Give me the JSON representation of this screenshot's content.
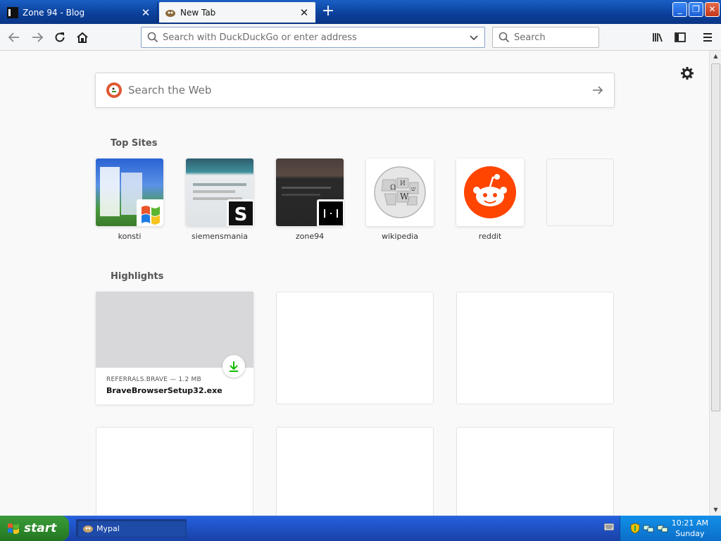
{
  "browser": {
    "tabs": [
      {
        "title": "Zone 94 - Blog",
        "active": false
      },
      {
        "title": "New Tab",
        "active": true
      }
    ],
    "newtab_icon": "plus-icon",
    "window_buttons": [
      "minimize",
      "restore",
      "close"
    ]
  },
  "navbar": {
    "url_placeholder": "Search with DuckDuckGo or enter address",
    "search_placeholder": "Search",
    "icons": [
      "back-icon",
      "forward-icon",
      "reload-icon",
      "home-icon",
      "library-icon",
      "sidebar-icon",
      "menu-icon"
    ]
  },
  "newtab": {
    "websearch_placeholder": "Search the Web",
    "top_sites_title": "Top Sites",
    "top_sites": [
      {
        "label": "konsti"
      },
      {
        "label": "siemensmania"
      },
      {
        "label": "zone94"
      },
      {
        "label": "wikipedia"
      },
      {
        "label": "reddit"
      },
      {
        "label": ""
      }
    ],
    "highlights_title": "Highlights",
    "highlights": [
      {
        "source": "REFERRALS.BRAVE — 1.2 MB",
        "title": "BraveBrowserSetup32.exe"
      }
    ],
    "colors": {
      "reddit": "#ff4500",
      "duckduckgo": "#de5833",
      "download": "#12bc00"
    }
  },
  "taskbar": {
    "start_label": "start",
    "task_label": "Mypal",
    "time": "10:21 AM",
    "day": "Sunday"
  }
}
